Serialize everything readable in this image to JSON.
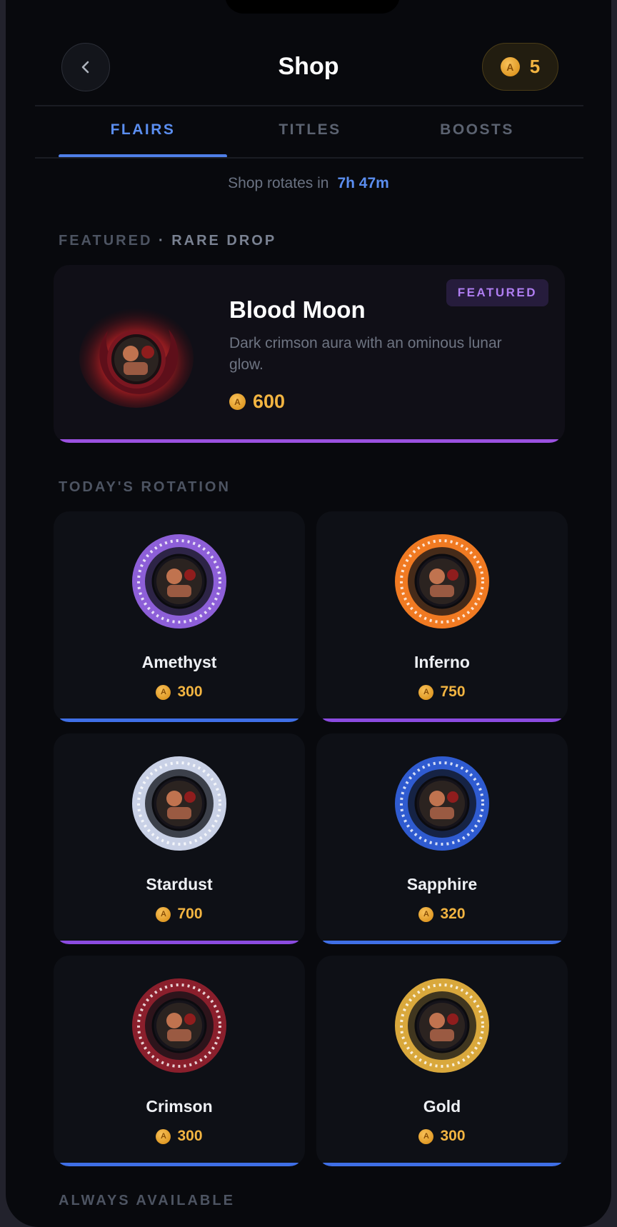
{
  "header": {
    "title": "Shop",
    "balance": "5"
  },
  "tabs": [
    {
      "label": "FLAIRS",
      "active": true
    },
    {
      "label": "TITLES",
      "active": false
    },
    {
      "label": "BOOSTS",
      "active": false
    }
  ],
  "rotation": {
    "label": "Shop rotates in",
    "time": "7h 47m"
  },
  "featured_section": {
    "label": "FEATURED",
    "separator": " · ",
    "sub": "RARE DROP"
  },
  "featured": {
    "badge": "FEATURED",
    "name": "Blood Moon",
    "description": "Dark crimson aura with an ominous lunar glow.",
    "price": "600",
    "accent": "#9b51e0"
  },
  "rotation_section": {
    "label": "TODAY'S ROTATION"
  },
  "items": [
    {
      "name": "Amethyst",
      "price": "300",
      "bar_color": "#3f6fe6",
      "ring_color": "#8d5fd8"
    },
    {
      "name": "Inferno",
      "price": "750",
      "bar_color": "#8b4be0",
      "ring_color": "#f07a22"
    },
    {
      "name": "Stardust",
      "price": "700",
      "bar_color": "#8b4be0",
      "ring_color": "#c9d1e6"
    },
    {
      "name": "Sapphire",
      "price": "320",
      "bar_color": "#3f6fe6",
      "ring_color": "#2f5bd0"
    },
    {
      "name": "Crimson",
      "price": "300",
      "bar_color": "#3f6fe6",
      "ring_color": "#8a1f2c"
    },
    {
      "name": "Gold",
      "price": "300",
      "bar_color": "#3f6fe6",
      "ring_color": "#d9a83c"
    }
  ],
  "always_section": {
    "label": "ALWAYS AVAILABLE"
  },
  "currency_icon": {
    "name": "coin-icon",
    "glyph": "A"
  }
}
